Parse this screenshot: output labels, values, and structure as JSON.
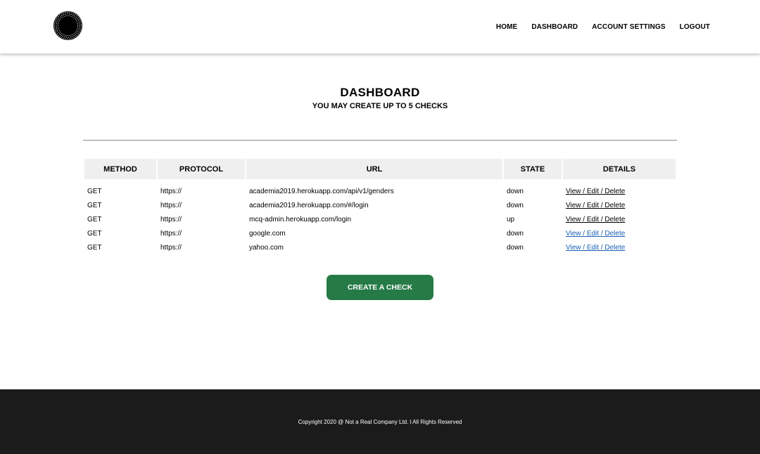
{
  "nav": {
    "home": "HOME",
    "dashboard": "DASHBOARD",
    "account_settings": "ACCOUNT SETTINGS",
    "logout": "LOGOUT"
  },
  "page": {
    "title": "DASHBOARD",
    "subtitle": "YOU MAY CREATE UP TO 5 CHECKS"
  },
  "table": {
    "headers": [
      "METHOD",
      "PROTOCOL",
      "URL",
      "STATE",
      "DETAILS"
    ],
    "rows": [
      {
        "method": "GET",
        "protocol": "https://",
        "url": "academia2019.herokuapp.com/api/v1/genders",
        "state": "down",
        "details": "View / Edit / Delete"
      },
      {
        "method": "GET",
        "protocol": "https://",
        "url": "academia2019.herokuapp.com/#/login",
        "state": "down",
        "details": "View / Edit / Delete"
      },
      {
        "method": "GET",
        "protocol": "https://",
        "url": "mcq-admin.herokuapp.com/login",
        "state": "up",
        "details": "View / Edit / Delete"
      },
      {
        "method": "GET",
        "protocol": "https://",
        "url": "google.com",
        "state": "down",
        "details": "View / Edit / Delete"
      },
      {
        "method": "GET",
        "protocol": "https://",
        "url": "yahoo.com",
        "state": "down",
        "details": "View / Edit / Delete"
      }
    ]
  },
  "actions": {
    "create_check": "CREATE A CHECK"
  },
  "footer": {
    "copyright": "Copyright 2020 @ Not a Real Company Ltd. l All Rights Reserved"
  },
  "colors": {
    "button_green": "#267a46",
    "footer_bg": "#1b1b1b",
    "header_cell_bg": "#efefef",
    "visited_link": "#1a5fb4"
  },
  "icons": {
    "logo": "circular-dotted-logo-icon"
  }
}
